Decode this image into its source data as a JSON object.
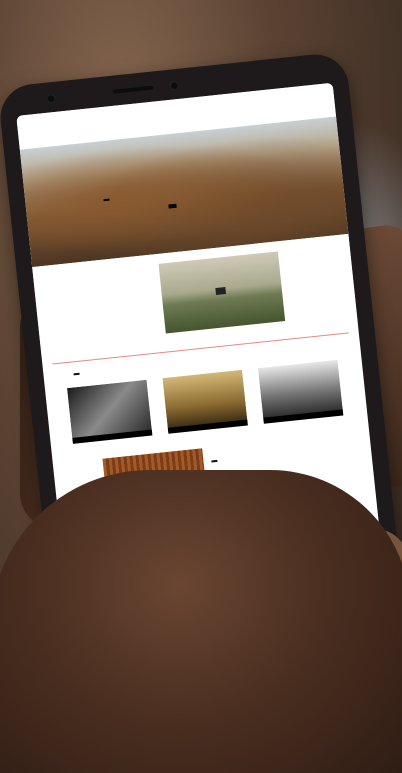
{
  "scene": {
    "description_icon": "hand-holding-smartphone",
    "colors": {
      "skin": "#5d3d2b",
      "phone": "#1e1a1c",
      "screen": "#ffffff",
      "accent_line": "#e08a8a"
    }
  },
  "website": {
    "logo": "",
    "nav_items": [
      "",
      "",
      "",
      "",
      "",
      "",
      "",
      "",
      ""
    ],
    "hero": {
      "title": "",
      "button": ""
    },
    "about": {
      "heading": "",
      "text": ""
    },
    "exhibitions": {
      "heading": "",
      "cards": [
        "",
        "",
        ""
      ]
    },
    "agenda": {
      "items": [
        "",
        "",
        "",
        ""
      ],
      "buttons": [
        "",
        ""
      ]
    }
  }
}
